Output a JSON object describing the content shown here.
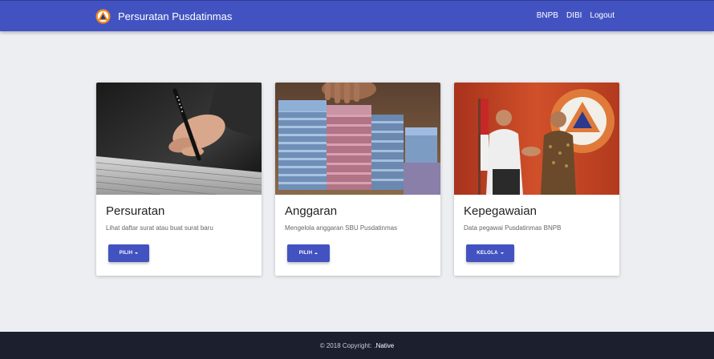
{
  "navbar": {
    "brand_icon": "bnpb-logo",
    "title": "Persuratan Pusdatinmas",
    "links": [
      "BNPB",
      "DIBI",
      "Logout"
    ],
    "background": "#4253c1"
  },
  "cards": [
    {
      "image": "hand-writing-photo",
      "title": "Persuratan",
      "description": "Lihat daftar surat atau buat surat baru",
      "button_label": "PILIH",
      "button_caret": "down"
    },
    {
      "image": "money-stacks-photo",
      "title": "Anggaran",
      "description": "Mengelola anggaran SBU Pusdatinmas",
      "button_label": "PILIH",
      "button_caret": "up"
    },
    {
      "image": "handshake-photo",
      "title": "Kepegawaian",
      "description": "Data pegawai Pusdatinmas BNPB",
      "button_label": "KELOLA",
      "button_caret": "down"
    }
  ],
  "footer": {
    "copyright": "© 2018 Copyright:",
    "link": ".Native",
    "background": "#1b1f2e"
  },
  "colors": {
    "accent": "#4253c1",
    "page_background": "#eceef2"
  }
}
